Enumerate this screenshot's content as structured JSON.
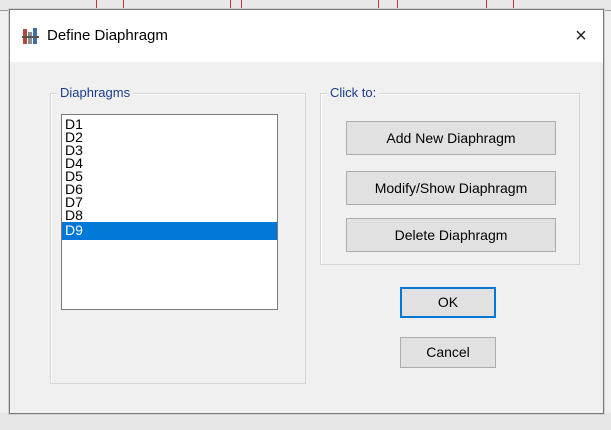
{
  "window": {
    "title": "Define Diaphragm",
    "close_glyph": "×"
  },
  "diaphragms_group": {
    "label": "Diaphragms",
    "items": [
      "D1",
      "D2",
      "D3",
      "D4",
      "D5",
      "D6",
      "D7",
      "D8",
      "D9"
    ],
    "selected_item": "D9"
  },
  "click_to_group": {
    "label": "Click to:",
    "add_label": "Add New Diaphragm",
    "modify_label": "Modify/Show Diaphragm",
    "delete_label": "Delete Diaphragm"
  },
  "buttons": {
    "ok_label": "OK",
    "cancel_label": "Cancel"
  },
  "colors": {
    "selection": "#0078d7",
    "group_label": "#1a3b8e"
  },
  "icons": {
    "app": "diaphragm-app-icon",
    "close": "close-icon"
  }
}
